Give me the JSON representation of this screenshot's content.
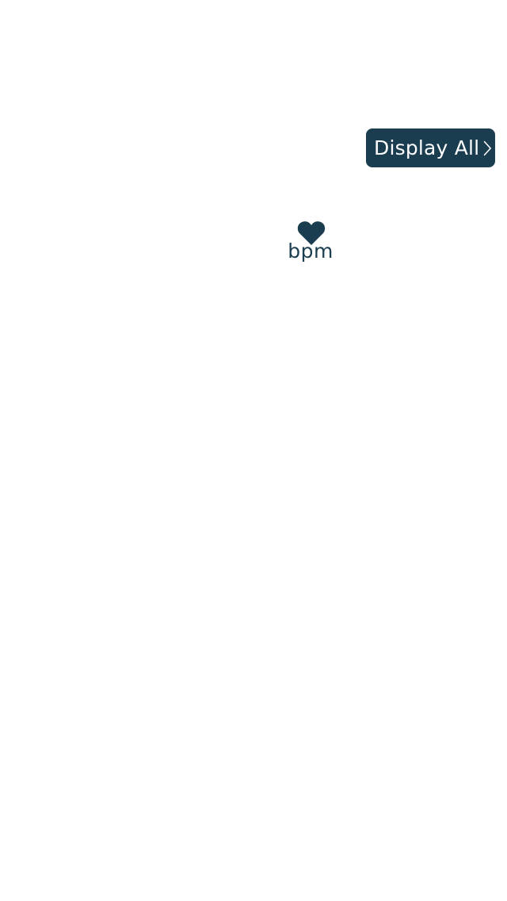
{
  "header": {
    "display_all_label": "Display All"
  },
  "heart_rate": {
    "unit_label": "bpm"
  },
  "colors": {
    "accent": "#1a3d50",
    "background": "#ffffff",
    "button_text": "#ffffff"
  },
  "icons": {
    "heart": "heart-icon",
    "chevron": "chevron-right-icon"
  }
}
